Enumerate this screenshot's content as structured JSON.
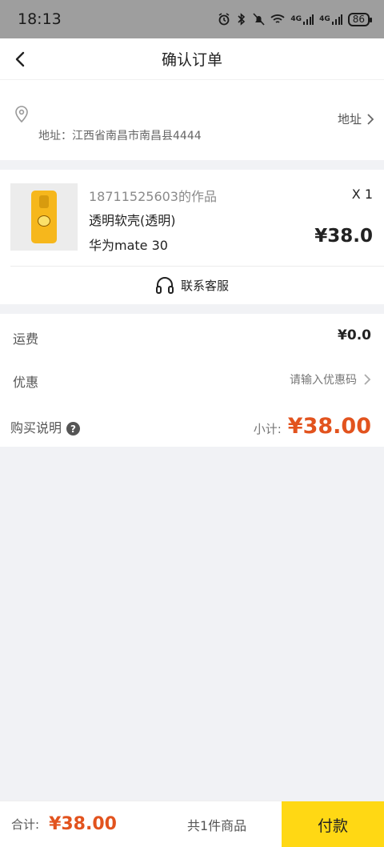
{
  "status_bar": {
    "time": "18:13",
    "network_1": "4G",
    "network_2": "4G",
    "battery": "86"
  },
  "nav": {
    "title": "确认订单"
  },
  "address": {
    "text": "地址：江西省南昌市南昌县4444",
    "link_label": "地址"
  },
  "product": {
    "author": "18711525603的作品",
    "name": "透明软壳(透明)",
    "model": "华为mate 30",
    "quantity": "X 1",
    "price": "¥38.0",
    "image_color": "#f6b71c"
  },
  "service": {
    "label": "联系客服"
  },
  "summary": {
    "shipping_label": "运费",
    "shipping_value": "¥0.0",
    "coupon_label": "优惠",
    "coupon_placeholder": "请输入优惠码",
    "purchase_notes_label": "购买说明",
    "subtotal_label": "小计:",
    "subtotal_value": "¥38.00"
  },
  "bottom_bar": {
    "total_label": "合计:",
    "total_value": "¥38.00",
    "item_count": "共1件商品",
    "pay_label": "付款"
  },
  "colors": {
    "accent_price": "#e2531e",
    "pay_button": "#ffd814"
  }
}
